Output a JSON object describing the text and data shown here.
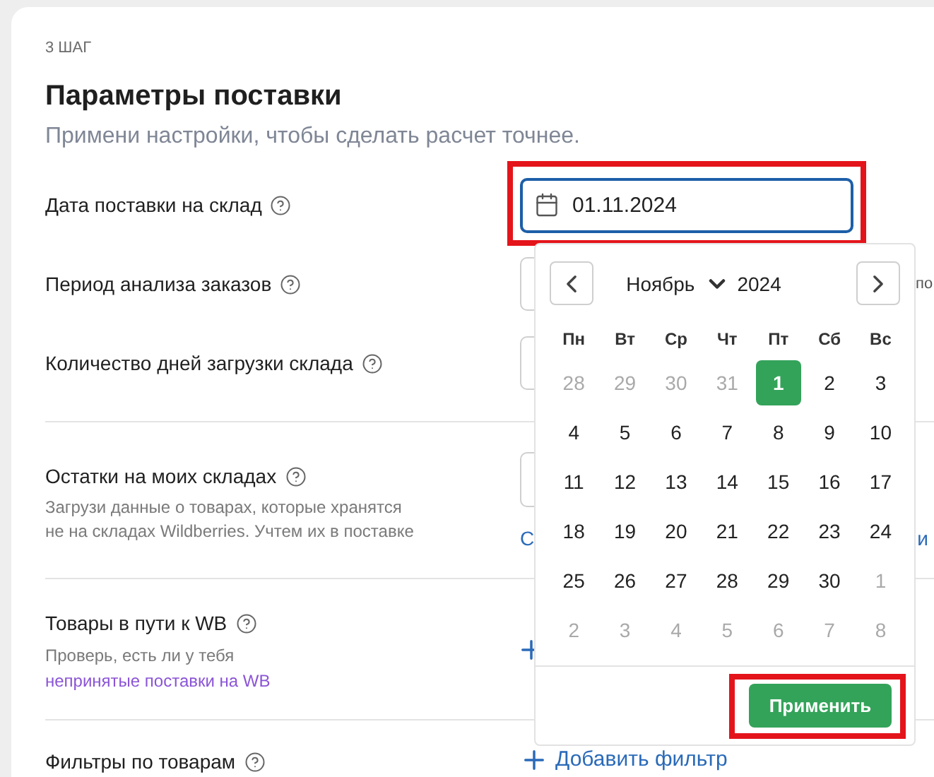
{
  "step": "3 ШАГ",
  "title": "Параметры поставки",
  "subtitle": "Примени настройки, чтобы сделать расчет точнее.",
  "rows": [
    {
      "kind": "date",
      "label": "Дата поставки на склад",
      "value": "01.11.2024",
      "focused": true,
      "highlighted": true
    },
    {
      "kind": "field",
      "label": "Период анализа заказов",
      "trailing": "по"
    },
    {
      "kind": "field",
      "label": "Количество дней загрузки склада"
    }
  ],
  "sections": [
    {
      "kind": "upload",
      "label": "Остатки на моих складах",
      "description_lines": [
        "Загрузи данные о товарах, которые хранятся",
        "не на складах Wildberries. Учтем их в поставке"
      ],
      "link_start": "С",
      "link_end": "и"
    },
    {
      "kind": "plus",
      "label": "Товары в пути к WB",
      "description": "Проверь, есть ли у тебя",
      "link": "непринятые поставки на WB"
    },
    {
      "kind": "add",
      "label": "Фильтры по товарам",
      "action": "Добавить фильтр"
    }
  ],
  "calendar": {
    "month": "Ноябрь",
    "year": "2024",
    "weekdays": [
      "Пн",
      "Вт",
      "Ср",
      "Чт",
      "Пт",
      "Сб",
      "Вс"
    ],
    "days": [
      {
        "label": "28",
        "outside": true,
        "selected": false
      },
      {
        "label": "29",
        "outside": true,
        "selected": false
      },
      {
        "label": "30",
        "outside": true,
        "selected": false
      },
      {
        "label": "31",
        "outside": true,
        "selected": false
      },
      {
        "label": "1",
        "outside": false,
        "selected": true
      },
      {
        "label": "2",
        "outside": false,
        "selected": false
      },
      {
        "label": "3",
        "outside": false,
        "selected": false
      },
      {
        "label": "4",
        "outside": false,
        "selected": false
      },
      {
        "label": "5",
        "outside": false,
        "selected": false
      },
      {
        "label": "6",
        "outside": false,
        "selected": false
      },
      {
        "label": "7",
        "outside": false,
        "selected": false
      },
      {
        "label": "8",
        "outside": false,
        "selected": false
      },
      {
        "label": "9",
        "outside": false,
        "selected": false
      },
      {
        "label": "10",
        "outside": false,
        "selected": false
      },
      {
        "label": "11",
        "outside": false,
        "selected": false
      },
      {
        "label": "12",
        "outside": false,
        "selected": false
      },
      {
        "label": "13",
        "outside": false,
        "selected": false
      },
      {
        "label": "14",
        "outside": false,
        "selected": false
      },
      {
        "label": "15",
        "outside": false,
        "selected": false
      },
      {
        "label": "16",
        "outside": false,
        "selected": false
      },
      {
        "label": "17",
        "outside": false,
        "selected": false
      },
      {
        "label": "18",
        "outside": false,
        "selected": false
      },
      {
        "label": "19",
        "outside": false,
        "selected": false
      },
      {
        "label": "20",
        "outside": false,
        "selected": false
      },
      {
        "label": "21",
        "outside": false,
        "selected": false
      },
      {
        "label": "22",
        "outside": false,
        "selected": false
      },
      {
        "label": "23",
        "outside": false,
        "selected": false
      },
      {
        "label": "24",
        "outside": false,
        "selected": false
      },
      {
        "label": "25",
        "outside": false,
        "selected": false
      },
      {
        "label": "26",
        "outside": false,
        "selected": false
      },
      {
        "label": "27",
        "outside": false,
        "selected": false
      },
      {
        "label": "28",
        "outside": false,
        "selected": false
      },
      {
        "label": "29",
        "outside": false,
        "selected": false
      },
      {
        "label": "30",
        "outside": false,
        "selected": false
      },
      {
        "label": "1",
        "outside": true,
        "selected": false
      },
      {
        "label": "2",
        "outside": true,
        "selected": false
      },
      {
        "label": "3",
        "outside": true,
        "selected": false
      },
      {
        "label": "4",
        "outside": true,
        "selected": false
      },
      {
        "label": "5",
        "outside": true,
        "selected": false
      },
      {
        "label": "6",
        "outside": true,
        "selected": false
      },
      {
        "label": "7",
        "outside": true,
        "selected": false
      },
      {
        "label": "8",
        "outside": true,
        "selected": false
      }
    ],
    "apply": "Применить",
    "apply_highlighted": true
  }
}
